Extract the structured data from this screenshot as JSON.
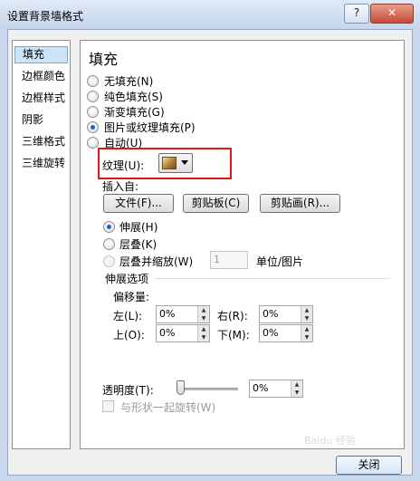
{
  "window": {
    "title": "设置背景墙格式",
    "help_label": "?",
    "close_label": "✕"
  },
  "nav": {
    "items": [
      {
        "label": "填充",
        "selected": true
      },
      {
        "label": "边框颜色"
      },
      {
        "label": "边框样式"
      },
      {
        "label": "阴影"
      },
      {
        "label": "三维格式"
      },
      {
        "label": "三维旋转"
      }
    ]
  },
  "fill": {
    "heading": "填充",
    "options": [
      {
        "label": "无填充(N)",
        "checked": false
      },
      {
        "label": "纯色填充(S)",
        "checked": false
      },
      {
        "label": "渐变填充(G)",
        "checked": false
      },
      {
        "label": "图片或纹理填充(P)",
        "checked": true
      },
      {
        "label": "自动(U)",
        "checked": false
      }
    ],
    "texture_label": "纹理(U):",
    "insert_from_label": "插入自:",
    "file_button": "文件(F)...",
    "clipboard_button": "剪贴板(C)",
    "clipart_button": "剪贴画(R)...",
    "stretch_label": "伸展(H)",
    "tile_label": "层叠(K)",
    "stack_scale_label": "层叠并缩放(W)",
    "stack_value": "1",
    "unit_label": "单位/图片",
    "stretch_options_label": "伸展选项",
    "offset_label": "偏移量:",
    "left_label": "左(L):",
    "left_value": "0%",
    "right_label": "右(R):",
    "right_value": "0%",
    "top_label": "上(O):",
    "top_value": "0%",
    "bottom_label": "下(M):",
    "bottom_value": "0%",
    "transparency_label": "透明度(T):",
    "transparency_value": "0%",
    "transparency_level": 0,
    "rotate_with_shape_label": "与形状一起旋转(W)"
  },
  "footer": {
    "close_button": "关闭"
  },
  "watermark": {
    "text": "Baidu 经验"
  }
}
